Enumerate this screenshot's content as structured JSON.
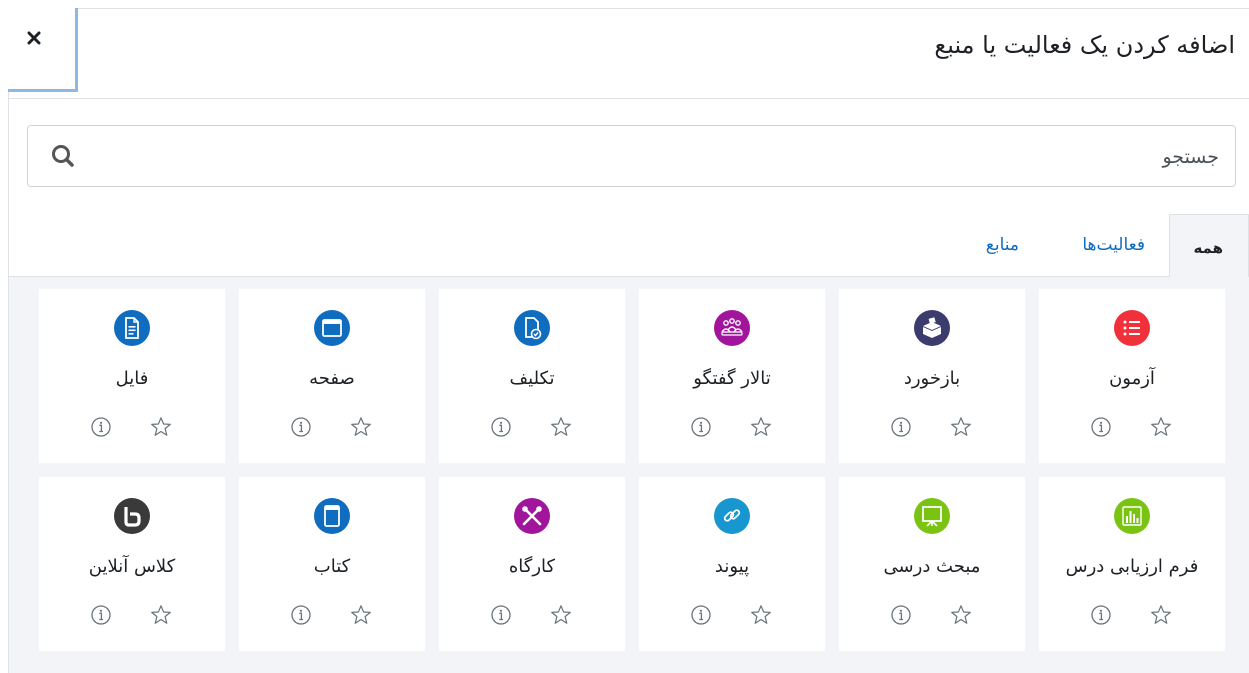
{
  "modal": {
    "title": "اضافه کردن یک فعالیت یا منبع",
    "close_icon": "close-icon"
  },
  "search": {
    "placeholder": "جستجو",
    "value": "",
    "icon": "search-icon"
  },
  "tabs": [
    {
      "label": "همه",
      "active": true
    },
    {
      "label": "فعالیت‌ها",
      "active": false
    },
    {
      "label": "منابع",
      "active": false
    }
  ],
  "items": [
    {
      "label": "آزمون",
      "icon": "quiz-list-icon",
      "color": "#f0303a"
    },
    {
      "label": "بازخورد",
      "icon": "feedback-box-icon",
      "color": "#3c3b6e"
    },
    {
      "label": "تالار گفتگو",
      "icon": "forum-people-icon",
      "color": "#a0159c"
    },
    {
      "label": "تکلیف",
      "icon": "assignment-file-check-icon",
      "color": "#0f6cbf"
    },
    {
      "label": "صفحه",
      "icon": "page-window-icon",
      "color": "#0f6cbf"
    },
    {
      "label": "فایل",
      "icon": "file-document-icon",
      "color": "#0f6cbf"
    },
    {
      "label": "فرم ارزیابی درس",
      "icon": "survey-chart-icon",
      "color": "#7ac313"
    },
    {
      "label": "مبحث درسی",
      "icon": "lesson-presentation-icon",
      "color": "#7ac313"
    },
    {
      "label": "پیوند",
      "icon": "url-link-icon",
      "color": "#1796d0"
    },
    {
      "label": "کارگاه",
      "icon": "workshop-tools-icon",
      "color": "#a0159c"
    },
    {
      "label": "کتاب",
      "icon": "book-icon",
      "color": "#0f6cbf"
    },
    {
      "label": "کلاس آنلاین",
      "icon": "bigbluebutton-icon",
      "color": "#3a3a3a"
    }
  ],
  "card_actions": {
    "info_icon": "info-icon",
    "star_icon": "star-outline-icon"
  }
}
